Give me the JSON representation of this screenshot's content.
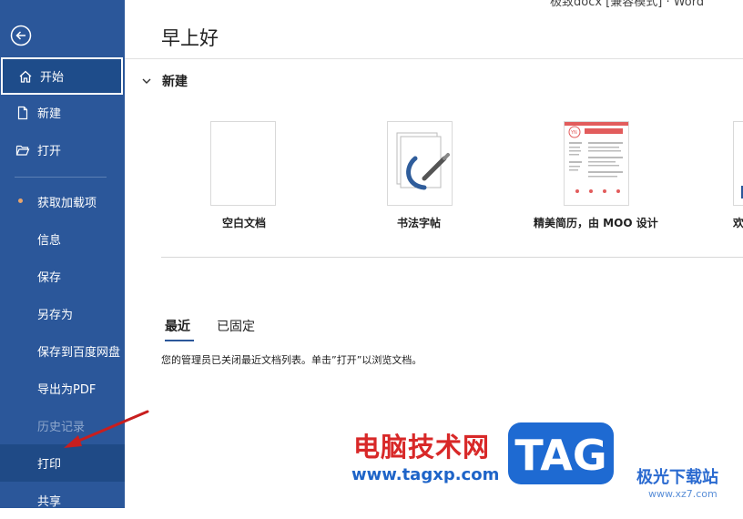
{
  "window": {
    "title_fragment": "极致docx [兼容模式] · Word"
  },
  "sidebar": {
    "back_icon": "back-arrow-circle-icon",
    "items": [
      {
        "label": "开始",
        "icon": "home-icon"
      },
      {
        "label": "新建",
        "icon": "new-document-icon"
      },
      {
        "label": "打开",
        "icon": "open-folder-icon"
      },
      {
        "label": "获取加载项"
      },
      {
        "label": "信息"
      },
      {
        "label": "保存"
      },
      {
        "label": "另存为"
      },
      {
        "label": "保存到百度网盘"
      },
      {
        "label": "导出为PDF"
      },
      {
        "label": "历史记录"
      },
      {
        "label": "打印"
      },
      {
        "label": "共享"
      }
    ]
  },
  "main": {
    "greeting": "早上好",
    "new_section": "新建",
    "templates": [
      {
        "label": "空白文档"
      },
      {
        "label": "书法字帖"
      },
      {
        "label": "精美简历，由 MOO 设计"
      },
      {
        "label": "欢"
      }
    ],
    "tabs": [
      {
        "label": "最近"
      },
      {
        "label": "已固定"
      }
    ],
    "notice": "您的管理员已关闭最近文档列表。单击”打开”以浏览文档。"
  },
  "watermark": {
    "site_name": "电脑技术网",
    "url": "www.tagxp.com",
    "tag": "TAG",
    "brand": "极光下载站",
    "brand_url": "www.xz7.com"
  },
  "colors": {
    "sidebar": "#2b579a",
    "accent_red": "#d82828",
    "watermark_blue": "#1e64c8"
  }
}
